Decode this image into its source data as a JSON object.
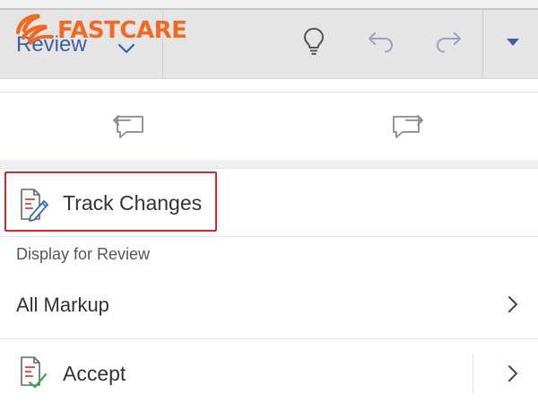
{
  "brand": {
    "name": "FASTCARE",
    "color": "#f06a25"
  },
  "toolbar": {
    "tab_label": "Review",
    "buttons": [
      "lightbulb-icon",
      "undo-icon",
      "redo-icon",
      "expand-caret-icon"
    ]
  },
  "comments": {
    "prev_icon": "previous-comment-icon",
    "next_icon": "next-comment-icon"
  },
  "review": {
    "track_changes_label": "Track Changes",
    "display_for_review_label": "Display for Review",
    "display_value": "All Markup",
    "accept_label": "Accept"
  },
  "colors": {
    "accent_blue": "#3b5ea8",
    "highlight_red": "#d4282e",
    "icon_gray": "#8a8a8a",
    "doc_red": "#d9463b",
    "accept_green": "#3aa657"
  }
}
